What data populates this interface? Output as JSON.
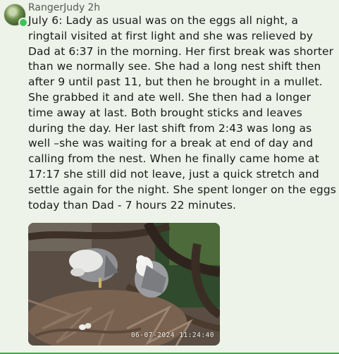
{
  "post": {
    "author": "RangerJudy",
    "time_ago": "2h",
    "body": "July 6: Lady as usual was on the eggs all night, a ringtail visited at first light and she was relieved by Dad at 6:37 in the morning. Her first break was shorter than we normally see. She had a long nest shift then after 9 until past 11, but then he brought in a mullet. She grabbed it and ate well. She then had a longer time away at last. Both brought sticks and leaves during the day. Her last shift from 2:43 was long as well –she was waiting for a break at end of day and calling from the nest. When he finally came home at 17:17 she still did not leave, just a quick stretch and settle again for the night. She spent longer on the eggs today than Dad - 7 hours 22 minutes."
  },
  "photo": {
    "timestamp": "06-07-2024 11:24:40"
  },
  "colors": {
    "online": "#3ec15a",
    "accent_line": "#34b24a"
  }
}
